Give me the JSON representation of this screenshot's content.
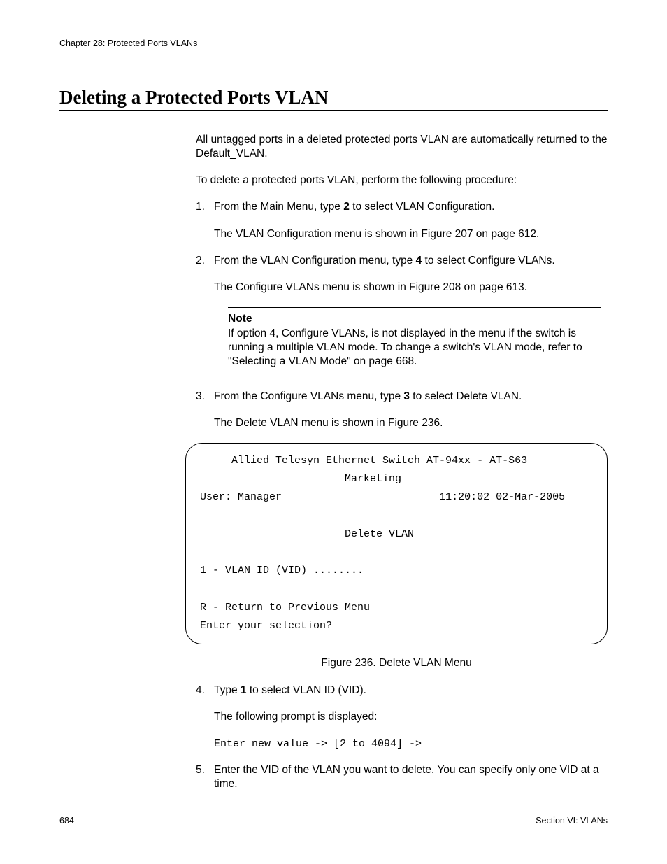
{
  "header": {
    "chapter": "Chapter 28: Protected Ports VLANs"
  },
  "title": "Deleting a Protected Ports VLAN",
  "intro1": "All untagged ports in a deleted protected ports VLAN are automatically returned to the Default_VLAN.",
  "intro2": "To delete a protected ports VLAN, perform the following procedure:",
  "steps": {
    "s1": {
      "num": "1.",
      "pre": "From the Main Menu, type ",
      "bold": "2",
      "post": " to select VLAN Configuration.",
      "sub": "The VLAN Configuration menu is shown in Figure 207 on page 612."
    },
    "s2": {
      "num": "2.",
      "pre": "From the VLAN Configuration menu, type ",
      "bold": "4",
      "post": " to select Configure VLANs.",
      "sub": "The Configure VLANs menu is shown in Figure 208 on page 613."
    },
    "note": {
      "title": "Note",
      "body": "If option 4, Configure VLANs, is not displayed in the menu if the switch is running a multiple VLAN mode. To change a switch's VLAN mode, refer to \"Selecting a VLAN Mode\" on page 668."
    },
    "s3": {
      "num": "3.",
      "pre": "From the Configure VLANs menu, type ",
      "bold": "3",
      "post": " to select Delete VLAN.",
      "sub": "The Delete VLAN menu is shown in Figure 236."
    },
    "s4": {
      "num": "4.",
      "pre": "Type ",
      "bold": "1",
      "post": " to select VLAN ID (VID).",
      "sub": "The following prompt is displayed:",
      "prompt": "Enter new value -> [2 to 4094] ->"
    },
    "s5": {
      "num": "5.",
      "text": "Enter the VID of the VLAN you want to delete. You can specify only one VID at a time."
    }
  },
  "terminal": {
    "line1": "     Allied Telesyn Ethernet Switch AT-94xx - AT-S63",
    "line2": "                       Marketing",
    "userline_left": "User: Manager",
    "userline_right": "11:20:02 02-Mar-2005",
    "menuTitle": "                       Delete VLAN",
    "opt1": "1 - VLAN ID (VID) ........",
    "optR": "R - Return to Previous Menu",
    "prompt": "Enter your selection?"
  },
  "figure_caption": "Figure 236. Delete VLAN Menu",
  "footer": {
    "page": "684",
    "section": "Section VI: VLANs"
  }
}
